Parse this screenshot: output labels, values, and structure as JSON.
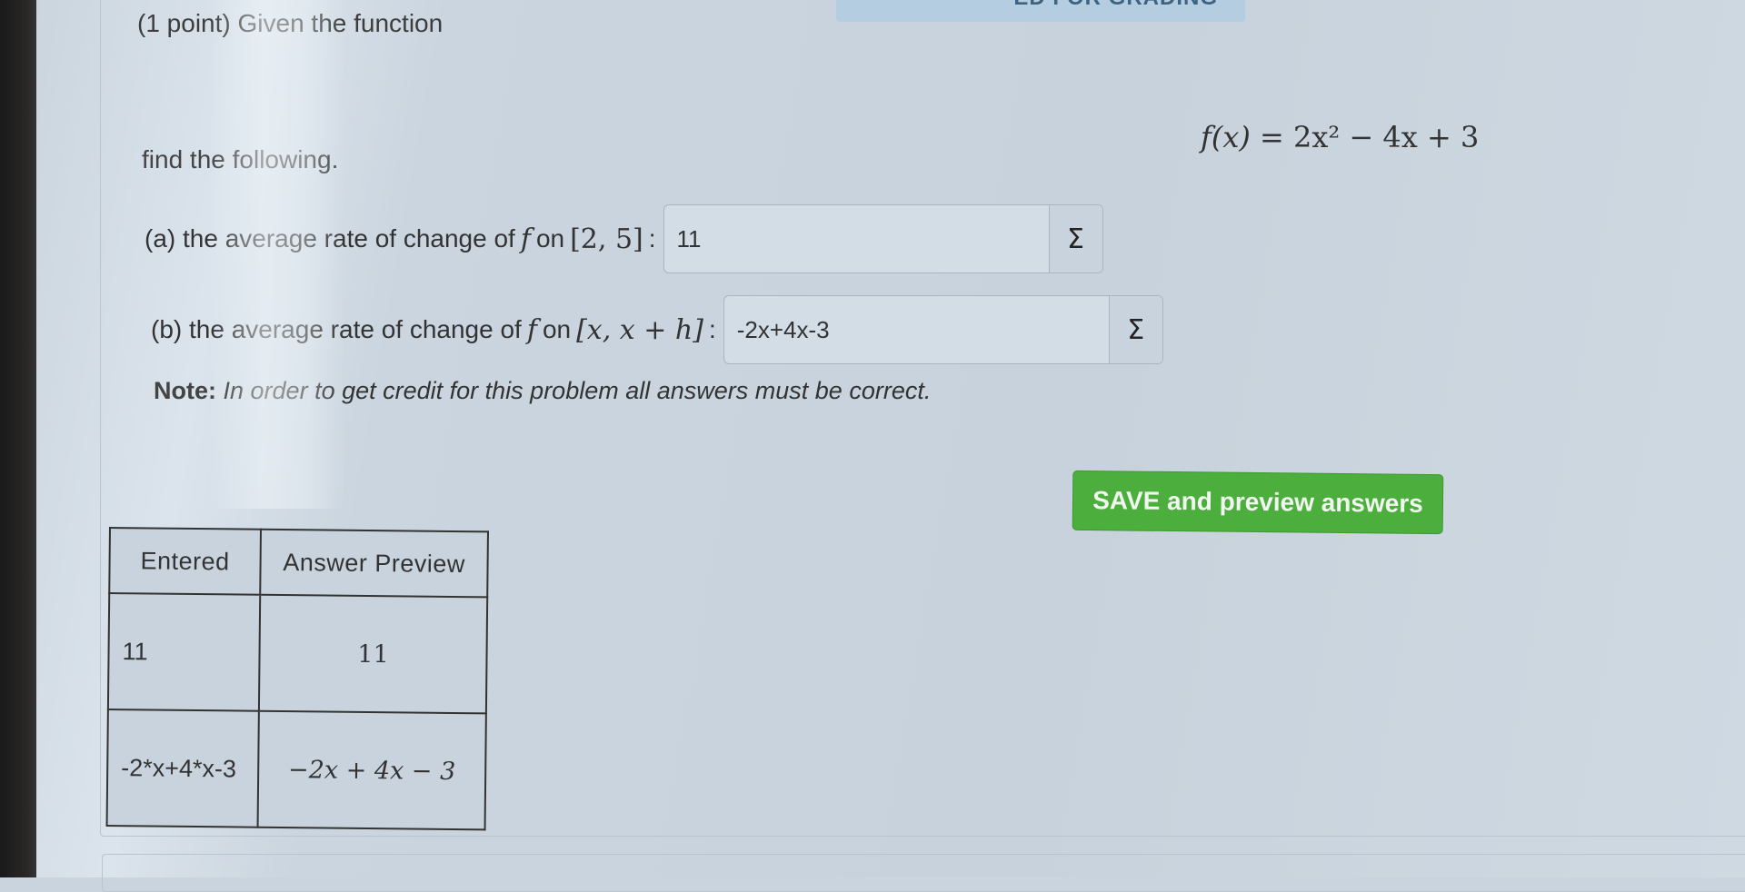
{
  "banner": {
    "text": "ED FOR GRADING"
  },
  "problem": {
    "intro": "(1 point) Given the function",
    "function": {
      "lhs": "f(x)",
      "equals": "=",
      "rhs": "2x² − 4x + 3"
    },
    "find_text": "find the following.",
    "parts": [
      {
        "prefix": "(a) the average rate of change of",
        "func_symbol": "f",
        "on": "on",
        "interval": "[2, 5]",
        "colon": ":",
        "answer_value": "11",
        "equation_editor_icon": "sigma-icon",
        "equation_editor_glyph": "Σ"
      },
      {
        "prefix": "(b) the average rate of change of",
        "func_symbol": "f",
        "on": "on",
        "interval": "[x, x + h]",
        "colon": ":",
        "answer_value": "-2x+4x-3",
        "equation_editor_icon": "sigma-icon",
        "equation_editor_glyph": "Σ"
      }
    ],
    "note_label": "Note:",
    "note_text": "In order to get credit for this problem all answers must be correct."
  },
  "actions": {
    "save_preview_label": "SAVE and preview answers",
    "save_preview_color": "#4cae3c"
  },
  "preview_table": {
    "headers": [
      "Entered",
      "Answer Preview"
    ],
    "rows": [
      {
        "entered": "11",
        "preview": "11"
      },
      {
        "entered": "-2*x+4*x-3",
        "preview": "−2x + 4x − 3"
      }
    ]
  }
}
